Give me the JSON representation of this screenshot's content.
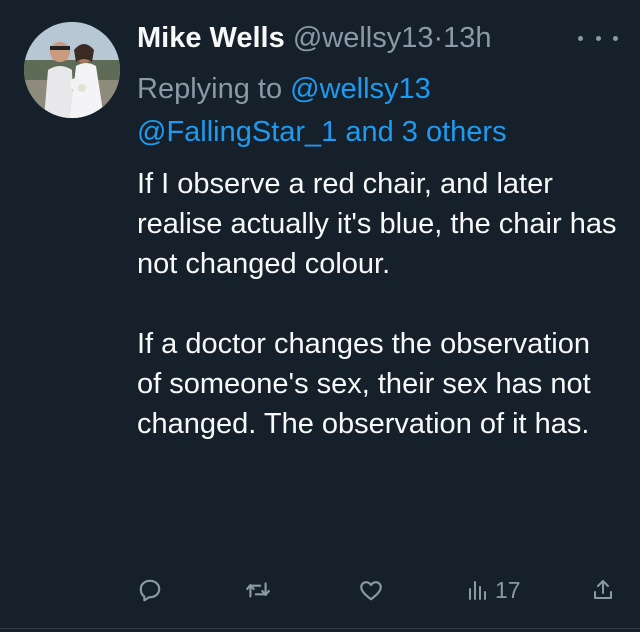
{
  "author": {
    "name": "Mike Wells",
    "handle": "@wellsy13",
    "separator": "·",
    "time": "13h"
  },
  "reply": {
    "prefix": "Replying to ",
    "to_handle": "@wellsy13",
    "others": "@FallingStar_1 and 3 others"
  },
  "text": {
    "paragraph_1": "If I observe a red chair, and later realise actually it's blue, the chair has not changed colour.",
    "paragraph_2": "If a doctor changes the observation of someone's sex, their sex has not changed. The observation of it has."
  },
  "actions": {
    "views_count": "17"
  },
  "colors": {
    "background": "#15202b",
    "text": "#f7f9f9",
    "secondary": "#8b98a5",
    "link": "#1d9bf0"
  },
  "icons": [
    "avatar-photo",
    "more-icon",
    "reply-icon",
    "retweet-icon",
    "like-icon",
    "views-icon",
    "share-icon"
  ]
}
